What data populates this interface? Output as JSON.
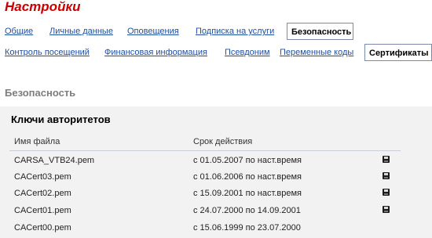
{
  "page": {
    "title": "Настройки"
  },
  "tabs": {
    "row1": [
      {
        "label": "Общие"
      },
      {
        "label": "Личные данные"
      },
      {
        "label": "Оповещения"
      },
      {
        "label": "Подписка на услуги"
      },
      {
        "label": "Безопасность",
        "active": true
      }
    ],
    "row2": [
      {
        "label": "Контроль посещений"
      },
      {
        "label": "Финансовая информация"
      },
      {
        "label": "Псевдоним"
      },
      {
        "label": "Переменные коды"
      },
      {
        "label": "Сертификаты",
        "active": true
      }
    ]
  },
  "section": {
    "title": "Безопасность"
  },
  "authorities": {
    "title": "Ключи авторитетов",
    "columns": {
      "file": "Имя файла",
      "validity": "Срок действия"
    },
    "rows": [
      {
        "file": "CARSA_VTB24.pem",
        "validity": "с 01.05.2007 по наст.время",
        "save_icon": "save-icon"
      },
      {
        "file": "CACert03.pem",
        "validity": "с 01.06.2006 по наст.время",
        "save_icon": "save-icon"
      },
      {
        "file": "CACert02.pem",
        "validity": "с 15.09.2001 по наст.время",
        "save_icon": "save-icon"
      },
      {
        "file": "CACert01.pem",
        "validity": "с 24.07.2000 по 14.09.2001",
        "save_icon": "save-icon"
      },
      {
        "file": "CACert00.pem",
        "validity": "с 15.06.1999 по 23.07.2000"
      }
    ]
  }
}
